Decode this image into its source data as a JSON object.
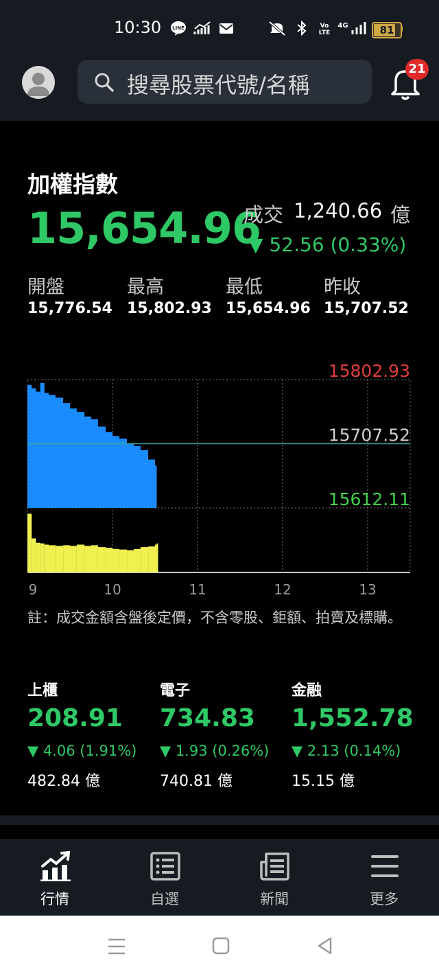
{
  "status_bar": {
    "time": "10:30",
    "battery": "81",
    "network": "4G",
    "icons": [
      "line-icon",
      "signal-graph-icon",
      "mail-icon",
      "mute-icon",
      "bluetooth-icon",
      "volte-icon",
      "cell-signal-icon",
      "battery-icon"
    ]
  },
  "header": {
    "search_placeholder": "搜尋股票代號/名稱",
    "notification_count": "21"
  },
  "index": {
    "title": "加權指數",
    "price": "15,654.96",
    "volume_label": "成交",
    "volume_value": "1,240.66",
    "volume_unit": "億",
    "change": "▼ 52.56 (0.33%)",
    "stats": [
      {
        "label": "開盤",
        "value": "15,776.54"
      },
      {
        "label": "最高",
        "value": "15,802.93"
      },
      {
        "label": "最低",
        "value": "15,654.96"
      },
      {
        "label": "昨收",
        "value": "15,707.52"
      }
    ]
  },
  "chart_data": {
    "type": "area",
    "title": "",
    "y_labels": {
      "high": "15802.93",
      "ref": "15707.52",
      "low": "15612.11"
    },
    "ylim": [
      15612.11,
      15802.93
    ],
    "reference": 15707.52,
    "x_ticks": [
      "9",
      "10",
      "11",
      "12",
      "13"
    ],
    "xlim": [
      9,
      13.5
    ],
    "colors": {
      "price_fill": "#1a8cff",
      "volume_fill": "#f0f050",
      "high_label": "#e03c3c",
      "ref_label": "#d0d0d0",
      "low_label": "#3fd24a",
      "ref_line": "#3aa6a0"
    },
    "price_series": {
      "x": [
        9.0,
        9.05,
        9.1,
        9.15,
        9.2,
        9.25,
        9.33,
        9.42,
        9.5,
        9.58,
        9.67,
        9.75,
        9.83,
        9.92,
        10.0,
        10.08,
        10.17,
        10.25,
        10.33,
        10.42,
        10.5,
        10.52
      ],
      "values": [
        15795,
        15790,
        15785,
        15798,
        15783,
        15780,
        15776,
        15768,
        15760,
        15755,
        15748,
        15744,
        15733,
        15725,
        15719,
        15715,
        15708,
        15704,
        15698,
        15684,
        15675,
        15672
      ]
    },
    "volume_series": {
      "x": [
        9.0,
        9.05,
        9.1,
        9.15,
        9.2,
        9.25,
        9.33,
        9.42,
        9.5,
        9.58,
        9.67,
        9.75,
        9.83,
        9.92,
        10.0,
        10.08,
        10.17,
        10.25,
        10.33,
        10.42,
        10.5,
        10.52
      ],
      "values": [
        0.95,
        0.55,
        0.48,
        0.47,
        0.45,
        0.44,
        0.43,
        0.44,
        0.43,
        0.45,
        0.43,
        0.44,
        0.41,
        0.4,
        0.38,
        0.37,
        0.36,
        0.38,
        0.41,
        0.42,
        0.45,
        0.47
      ]
    }
  },
  "note": "註：成交金額含盤後定價，不含零股、鉅額、拍賣及標購。",
  "sub_indices": [
    {
      "name": "上櫃",
      "price": "208.91",
      "change": "▼ 4.06 (1.91%)",
      "volume": "482.84 億"
    },
    {
      "name": "電子",
      "price": "734.83",
      "change": "▼ 1.93 (0.26%)",
      "volume": "740.81 億"
    },
    {
      "name": "金融",
      "price": "1,552.78",
      "change": "▼ 2.13 (0.14%)",
      "volume": "15.15 億"
    }
  ],
  "bottom_nav": [
    {
      "label": "行情",
      "icon": "market-chart-icon",
      "active": true
    },
    {
      "label": "自選",
      "icon": "watchlist-icon",
      "active": false
    },
    {
      "label": "新聞",
      "icon": "news-icon",
      "active": false
    },
    {
      "label": "更多",
      "icon": "menu-icon",
      "active": false
    }
  ]
}
